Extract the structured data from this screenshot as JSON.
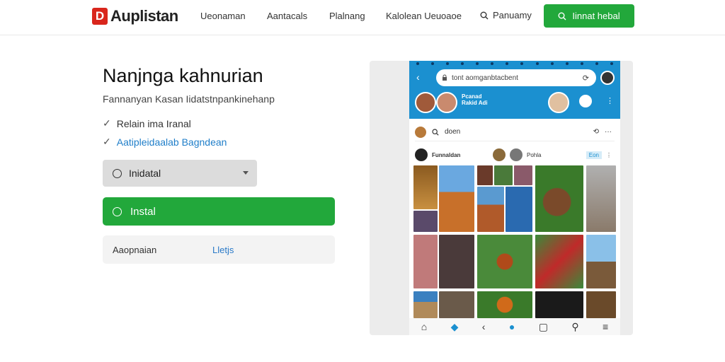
{
  "header": {
    "logo_mark": "D",
    "logo_text": "Auplistan",
    "nav": [
      "Ueonaman",
      "Aantacals",
      "Plalnang",
      "Kalolean Ueuoaoe"
    ],
    "search_label": "Panuamy",
    "cta_label": "Iinnat hebal"
  },
  "main": {
    "title": "Nanjnga kahnurian",
    "subtitle": "Fannanyan Kasan Iidatstnpankinehanp",
    "features": [
      {
        "label": "Relain ima Iranal",
        "color": "#333333"
      },
      {
        "label": "Aatipleidaalab Bagndean",
        "color": "#1f7ec9"
      }
    ],
    "select_value": "Inidatal",
    "install_label": "Instal",
    "info_row": {
      "label": "Aaopnaian",
      "link": "Lletjs"
    }
  },
  "mockup": {
    "url_text": "tont aomganbtacbent",
    "profile_name": "Pcanad",
    "profile_sub": "Rakid Adi",
    "search_text": "doen",
    "post_title": "Funnaldan",
    "post_sub": "Pohla",
    "post_tag": "Eon",
    "colors": {
      "accent": "#1b90d0",
      "brand_green": "#22a83b",
      "logo_red": "#d9261c"
    }
  }
}
